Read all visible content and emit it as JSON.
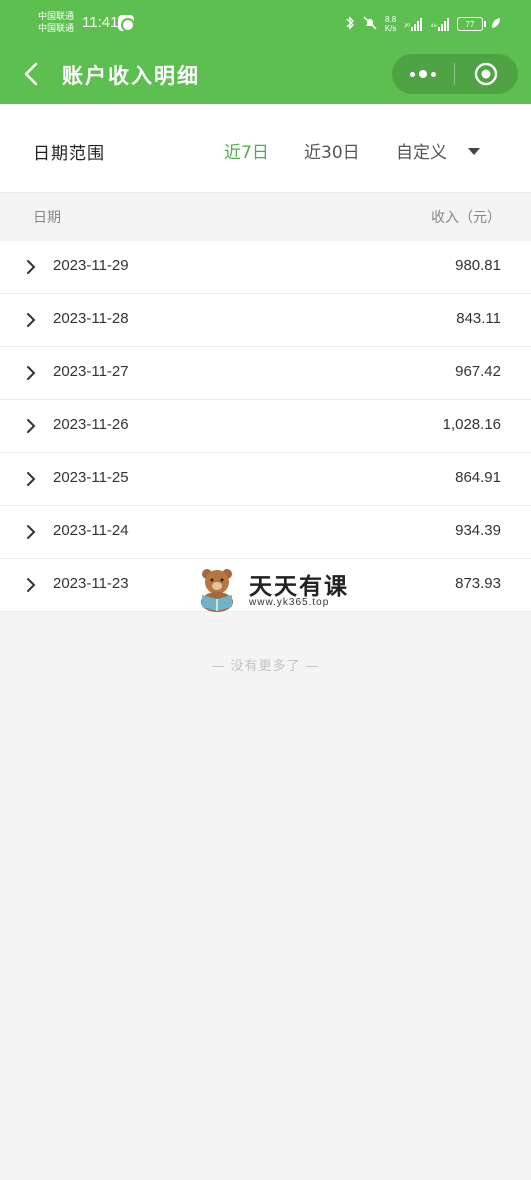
{
  "status_bar": {
    "carrier_1": "中国联通",
    "carrier_2": "中国联通",
    "time": "11:41",
    "net_speed": "8.8",
    "net_unit": "K/s",
    "signal_1": "²⁰",
    "signal_2": "⁴⁶",
    "battery": "77"
  },
  "nav": {
    "title": "账户收入明细",
    "back_icon": "chevron-left-icon",
    "more_icon": "more-dots-icon",
    "close_icon": "target-circle-icon"
  },
  "filter": {
    "label": "日期范围",
    "options": [
      "近7日",
      "近30日",
      "自定义"
    ],
    "active": "近7日",
    "accent_color": "#4fb04a"
  },
  "table": {
    "header_date": "日期",
    "header_income": "收入（元）",
    "rows": [
      {
        "date": "2023-11-29",
        "amount": "980.81"
      },
      {
        "date": "2023-11-28",
        "amount": "843.11"
      },
      {
        "date": "2023-11-27",
        "amount": "967.42"
      },
      {
        "date": "2023-11-26",
        "amount": "1,028.16"
      },
      {
        "date": "2023-11-25",
        "amount": "864.91"
      },
      {
        "date": "2023-11-24",
        "amount": "934.39"
      },
      {
        "date": "2023-11-23",
        "amount": "873.93"
      }
    ]
  },
  "footer": {
    "no_more": "— 没有更多了 —"
  },
  "watermark": {
    "name": "天天有课",
    "url": "www.yk365.top"
  },
  "colors": {
    "brand_green": "#5cbf4f"
  }
}
